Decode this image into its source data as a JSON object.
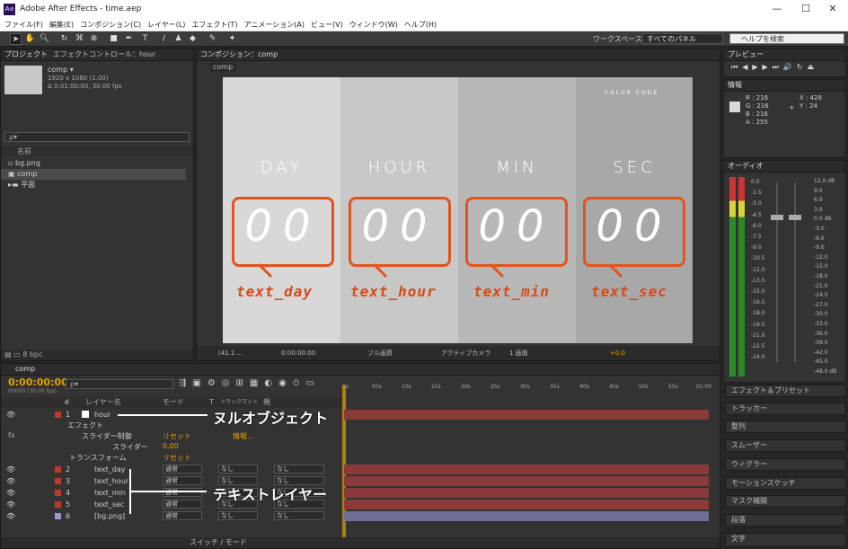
{
  "window": {
    "title": "Adobe After Effects - time.aep",
    "logo": "Ae",
    "minimize": "—",
    "maximize": "☐",
    "close": "✕"
  },
  "menu": [
    "ファイル(F)",
    "編集(E)",
    "コンポジション(C)",
    "レイヤー(L)",
    "エフェクト(T)",
    "アニメーション(A)",
    "ビュー(V)",
    "ウィンドウ(W)",
    "ヘルプ(H)"
  ],
  "toolbar": {
    "workspace_label": "ワークスペース：",
    "workspace_value": "すべてのパネル",
    "help_placeholder": "ヘルプを検索"
  },
  "project": {
    "tab1": "プロジェクト",
    "tab2": "エフェクトコントロール：hour",
    "comp_name": "comp ▾",
    "comp_info1": "1920 x 1080 (1.00)",
    "comp_info2": "Δ 0:01:00:00, 30.00 fps",
    "search": "ρ▾",
    "col_name": "名前",
    "items": [
      "bg.png",
      "comp",
      "平面"
    ],
    "bpc": "8 bpc"
  },
  "composition": {
    "tab": "コンポジション：comp",
    "breadcrumb": "comp",
    "logo": "COLOR CODE",
    "labels": [
      "DAY",
      "HOUR",
      "MIN",
      "SEC"
    ],
    "digits": [
      "00",
      "00",
      "00",
      "00"
    ],
    "layer_names": [
      "text_day",
      "text_hour",
      "text_min",
      "text_sec"
    ],
    "footer": {
      "zoom": "(41.1 ...",
      "time": "0:00:00:00",
      "quality": "フル画質",
      "camera": "アクティブカメラ",
      "views": "1 画面",
      "exposure": "+0.0"
    }
  },
  "right": {
    "preview": "プレビュー",
    "info": "情報",
    "info_r": "R : 216",
    "info_g": "G : 216",
    "info_b": "B : 216",
    "info_a": "A : 255",
    "info_x": "X : 428",
    "info_y": "Y : 24",
    "audio": "オーディオ",
    "audio_left": [
      "0.0",
      "-1.5",
      "-3.0",
      "-4.5",
      "-6.0",
      "-7.5",
      "-9.0",
      "-10.5",
      "-12.0",
      "-13.5",
      "-15.0",
      "-16.5",
      "-18.0",
      "-19.5",
      "-21.0",
      "-22.5",
      "-24.0"
    ],
    "audio_right": [
      "12.0 dB",
      "9.0",
      "6.0",
      "3.0",
      "0.0 dB",
      "-3.0",
      "-6.0",
      "-9.0",
      "-12.0",
      "-15.0",
      "-18.0",
      "-21.0",
      "-24.0",
      "-27.0",
      "-30.0",
      "-33.0",
      "-36.0",
      "-39.0",
      "-42.0",
      "-45.0",
      "-48.0 dB"
    ],
    "panels": [
      "エフェクト＆プリセット",
      "トラッカー",
      "整列",
      "スムーザー",
      "ウィグラー",
      "モーションスケッチ",
      "マスク補間",
      "段落",
      "文字"
    ]
  },
  "timeline": {
    "tab": "comp",
    "timecode": "0:00:00:00",
    "frames": "00000 (30.00 fps)",
    "search": "ρ▾",
    "col_num": "#",
    "col_name": "レイヤー名",
    "col_mode": "モード",
    "col_t": "T",
    "col_trk": "トラックマット",
    "col_parent": "親",
    "ruler": [
      "0s",
      "05s",
      "10s",
      "15s",
      "20s",
      "25s",
      "30s",
      "35s",
      "40s",
      "45s",
      "50s",
      "55s",
      "01:00"
    ],
    "layers": [
      {
        "num": "1",
        "name": "hour",
        "color": "#c0392b"
      },
      {
        "num": "2",
        "name": "text_day",
        "mode": "通常",
        "trk": "なし",
        "parent": "なし",
        "color": "#c0392b"
      },
      {
        "num": "3",
        "name": "text_hour",
        "mode": "通常",
        "trk": "なし",
        "parent": "なし",
        "color": "#c0392b"
      },
      {
        "num": "4",
        "name": "text_min",
        "mode": "通常",
        "trk": "なし",
        "parent": "なし",
        "color": "#c0392b"
      },
      {
        "num": "5",
        "name": "text_sec",
        "mode": "通常",
        "trk": "なし",
        "parent": "なし",
        "color": "#c0392b"
      },
      {
        "num": "6",
        "name": "[bg.png]",
        "mode": "通常",
        "trk": "なし",
        "parent": "なし",
        "color": "#9b9bd0"
      }
    ],
    "effects": "エフェクト",
    "slider_ctrl": "スライダー制御",
    "reset": "リセット",
    "info_link": "情報...",
    "slider": "スライダー",
    "slider_val": "0.00",
    "transform": "トランスフォーム",
    "fx": "fx",
    "switch_mode": "スイッチ / モード",
    "annot_null": "ヌルオブジェクト",
    "annot_text": "テキストレイヤー"
  }
}
